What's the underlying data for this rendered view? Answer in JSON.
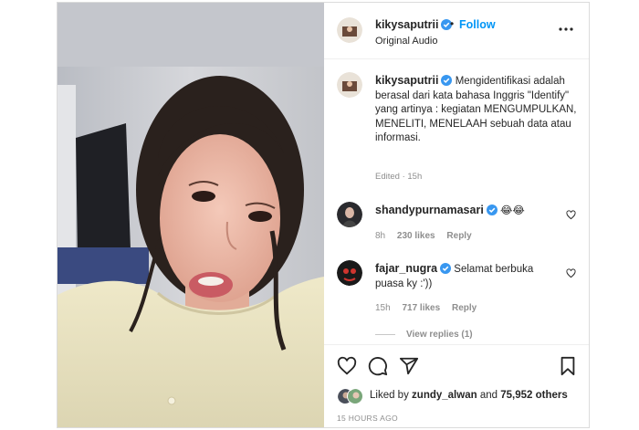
{
  "post": {
    "username": "kikysaputrii",
    "follow_label": "Follow",
    "separator": "•",
    "audio_label": "Original Audio",
    "caption": {
      "username": "kikysaputrii",
      "text": "Mengidentifikasi adalah berasal dari kata bahasa Inggris \"Identify\" yang artinya : kegiatan MENGUMPULKAN, MENELITI, MENELAAH sebuah data atau informasi.",
      "meta": "Edited · 15h"
    },
    "comments": [
      {
        "username": "shandypurnamasari",
        "text": "😂😂",
        "time": "8h",
        "likes": "230 likes",
        "reply": "Reply"
      },
      {
        "username": "fajar_nugra",
        "text": "Selamat berbuka puasa ky :'))",
        "time": "15h",
        "likes": "717 likes",
        "reply": "Reply"
      }
    ],
    "view_replies": "View replies (1)",
    "liked_by": {
      "prefix": "Liked by",
      "user": "zundy_alwan",
      "middle": "and",
      "others": "75,952 others"
    },
    "timestamp": "15 HOURS AGO"
  },
  "colors": {
    "accent": "#0095f6",
    "muted": "#8e8e8e",
    "text": "#262626"
  },
  "icons": [
    "verified-badge-icon",
    "more-options-icon",
    "heart-icon",
    "comment-icon",
    "share-icon",
    "bookmark-icon"
  ]
}
